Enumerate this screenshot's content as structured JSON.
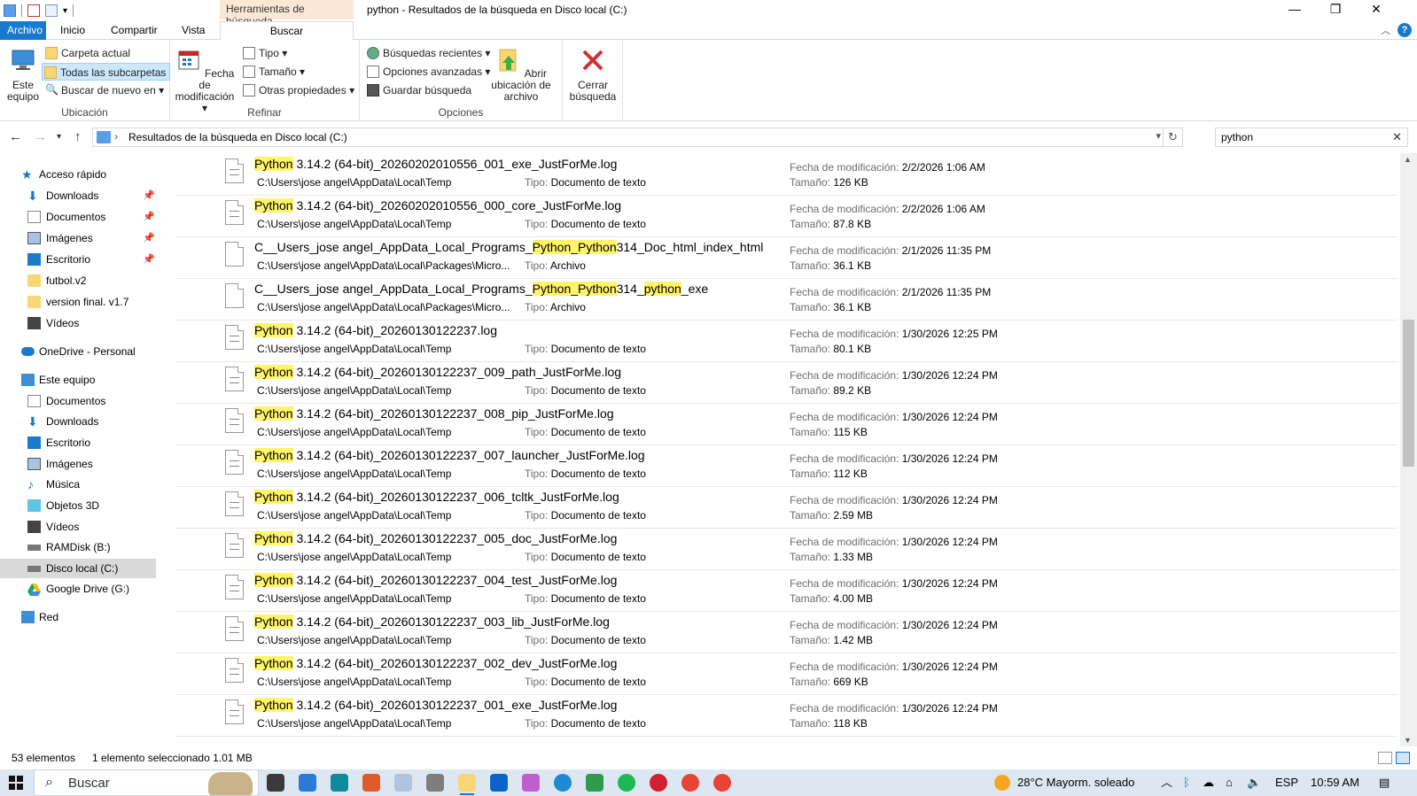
{
  "titlebar": {
    "contextual_tab_header": "Herramientas de búsqueda",
    "window_title": "python - Resultados de la búsqueda en Disco local (C:)",
    "minimize": "—",
    "restore": "❐",
    "close": "✕"
  },
  "tabs": {
    "file": "Archivo",
    "home": "Inicio",
    "share": "Compartir",
    "view": "Vista",
    "search": "Buscar"
  },
  "ribbon": {
    "location": {
      "this_pc": "Este equipo",
      "current_folder": "Carpeta actual",
      "all_subfolders": "Todas las subcarpetas",
      "search_again": "Buscar de nuevo en",
      "group_label": "Ubicación"
    },
    "refine": {
      "date_modified": "Fecha de modificación",
      "type": "Tipo",
      "size": "Tamaño",
      "other_props": "Otras propiedades",
      "group_label": "Refinar"
    },
    "options": {
      "recent_searches": "Búsquedas recientes",
      "advanced": "Opciones avanzadas",
      "save_search": "Guardar búsqueda",
      "open_location": "Abrir ubicación de archivo",
      "group_label": "Opciones"
    },
    "close_search": "Cerrar búsqueda"
  },
  "address": {
    "path": "Resultados de la búsqueda en Disco local (C:)",
    "search_value": "python"
  },
  "nav": {
    "quick_access": "Acceso rápido",
    "qa_downloads": "Downloads",
    "qa_documents": "Documentos",
    "qa_images": "Imágenes",
    "qa_desktop": "Escritorio",
    "futbol": "futbol.v2",
    "version_final": "version final. v1.7",
    "qa_videos": "Vídeos",
    "onedrive": "OneDrive - Personal",
    "this_pc": "Este equipo",
    "pc_documents": "Documentos",
    "pc_downloads": "Downloads",
    "pc_desktop": "Escritorio",
    "pc_images": "Imágenes",
    "pc_music": "Música",
    "pc_3d": "Objetos 3D",
    "pc_videos": "Vídeos",
    "ramdisk": "RAMDisk (B:)",
    "local_disk": "Disco local (C:)",
    "gdrive": "Google Drive (G:)",
    "network": "Red"
  },
  "labels": {
    "type": "Tipo:",
    "date": "Fecha de modificación:",
    "size": "Tamaño:"
  },
  "results": [
    {
      "pre": "",
      "hl": "Python",
      "post": " 3.14.2 (64-bit)_20260202010556_001_exe_JustForMe.log",
      "path": "C:\\Users\\jose angel\\AppData\\Local\\Temp",
      "type": "Documento de texto",
      "date": "2/2/2026 1:06 AM",
      "size": "126 KB",
      "icon": "text"
    },
    {
      "pre": "",
      "hl": "Python",
      "post": " 3.14.2 (64-bit)_20260202010556_000_core_JustForMe.log",
      "path": "C:\\Users\\jose angel\\AppData\\Local\\Temp",
      "type": "Documento de texto",
      "date": "2/2/2026 1:06 AM",
      "size": "87.8 KB",
      "icon": "text"
    },
    {
      "pre": "C__Users_jose angel_AppData_Local_Programs_",
      "hl": "Python_Python",
      "post": "314_Doc_html_index_html",
      "path": "C:\\Users\\jose angel\\AppData\\Local\\Packages\\Micro...",
      "type": "Archivo",
      "date": "2/1/2026 11:35 PM",
      "size": "36.1 KB",
      "icon": "blank"
    },
    {
      "pre": "C__Users_jose angel_AppData_Local_Programs_",
      "hl": "Python_Python",
      "post": "314_",
      "hl2": "python",
      "post2": "_exe",
      "path": "C:\\Users\\jose angel\\AppData\\Local\\Packages\\Micro...",
      "type": "Archivo",
      "date": "2/1/2026 11:35 PM",
      "size": "36.1 KB",
      "icon": "blank"
    },
    {
      "pre": "",
      "hl": "Python",
      "post": " 3.14.2 (64-bit)_20260130122237.log",
      "path": "C:\\Users\\jose angel\\AppData\\Local\\Temp",
      "type": "Documento de texto",
      "date": "1/30/2026 12:25 PM",
      "size": "80.1 KB",
      "icon": "text"
    },
    {
      "pre": "",
      "hl": "Python",
      "post": " 3.14.2 (64-bit)_20260130122237_009_path_JustForMe.log",
      "path": "C:\\Users\\jose angel\\AppData\\Local\\Temp",
      "type": "Documento de texto",
      "date": "1/30/2026 12:24 PM",
      "size": "89.2 KB",
      "icon": "text"
    },
    {
      "pre": "",
      "hl": "Python",
      "post": " 3.14.2 (64-bit)_20260130122237_008_pip_JustForMe.log",
      "path": "C:\\Users\\jose angel\\AppData\\Local\\Temp",
      "type": "Documento de texto",
      "date": "1/30/2026 12:24 PM",
      "size": "115 KB",
      "icon": "text"
    },
    {
      "pre": "",
      "hl": "Python",
      "post": " 3.14.2 (64-bit)_20260130122237_007_launcher_JustForMe.log",
      "path": "C:\\Users\\jose angel\\AppData\\Local\\Temp",
      "type": "Documento de texto",
      "date": "1/30/2026 12:24 PM",
      "size": "112 KB",
      "icon": "text"
    },
    {
      "pre": "",
      "hl": "Python",
      "post": " 3.14.2 (64-bit)_20260130122237_006_tcltk_JustForMe.log",
      "path": "C:\\Users\\jose angel\\AppData\\Local\\Temp",
      "type": "Documento de texto",
      "date": "1/30/2026 12:24 PM",
      "size": "2.59 MB",
      "icon": "text"
    },
    {
      "pre": "",
      "hl": "Python",
      "post": " 3.14.2 (64-bit)_20260130122237_005_doc_JustForMe.log",
      "path": "C:\\Users\\jose angel\\AppData\\Local\\Temp",
      "type": "Documento de texto",
      "date": "1/30/2026 12:24 PM",
      "size": "1.33 MB",
      "icon": "text"
    },
    {
      "pre": "",
      "hl": "Python",
      "post": " 3.14.2 (64-bit)_20260130122237_004_test_JustForMe.log",
      "path": "C:\\Users\\jose angel\\AppData\\Local\\Temp",
      "type": "Documento de texto",
      "date": "1/30/2026 12:24 PM",
      "size": "4.00 MB",
      "icon": "text"
    },
    {
      "pre": "",
      "hl": "Python",
      "post": " 3.14.2 (64-bit)_20260130122237_003_lib_JustForMe.log",
      "path": "C:\\Users\\jose angel\\AppData\\Local\\Temp",
      "type": "Documento de texto",
      "date": "1/30/2026 12:24 PM",
      "size": "1.42 MB",
      "icon": "text"
    },
    {
      "pre": "",
      "hl": "Python",
      "post": " 3.14.2 (64-bit)_20260130122237_002_dev_JustForMe.log",
      "path": "C:\\Users\\jose angel\\AppData\\Local\\Temp",
      "type": "Documento de texto",
      "date": "1/30/2026 12:24 PM",
      "size": "669 KB",
      "icon": "text"
    },
    {
      "pre": "",
      "hl": "Python",
      "post": " 3.14.2 (64-bit)_20260130122237_001_exe_JustForMe.log",
      "path": "C:\\Users\\jose angel\\AppData\\Local\\Temp",
      "type": "Documento de texto",
      "date": "1/30/2026 12:24 PM",
      "size": "118 KB",
      "icon": "text"
    }
  ],
  "status": {
    "count": "53 elementos",
    "selection": "1 elemento seleccionado  1.01 MB"
  },
  "taskbar": {
    "search_placeholder": "Buscar",
    "weather": "28°C  Mayorm. soleado",
    "lang": "ESP",
    "time": "10:59 AM"
  },
  "colors": {
    "accent": "#1979ca",
    "highlight": "#fff46a",
    "tools_tab": "#fbe7d4",
    "selected_nav": "#d9d9d9"
  }
}
